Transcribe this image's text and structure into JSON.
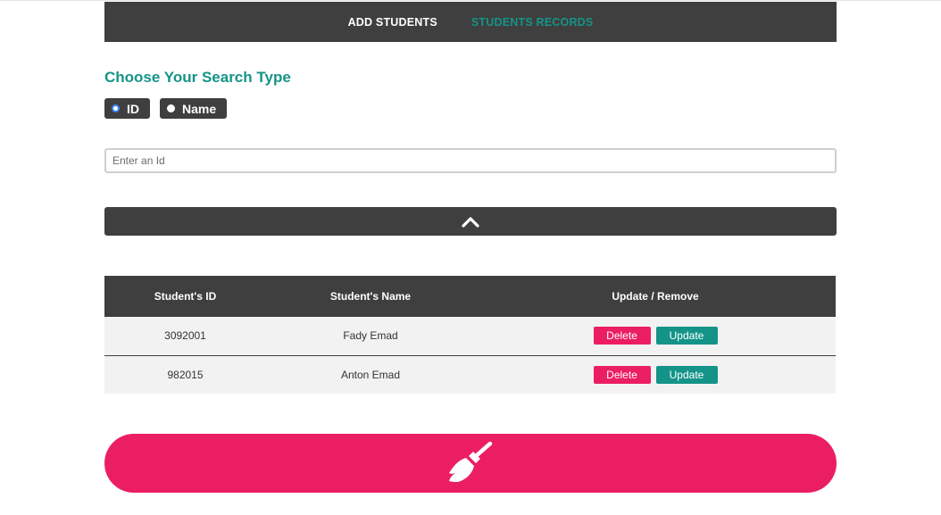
{
  "nav": {
    "add_students": "ADD STUDENTS",
    "students_records": "STUDENTS RECORDS"
  },
  "search": {
    "title": "Choose Your Search Type",
    "options": [
      {
        "label": "ID",
        "checked": true
      },
      {
        "label": "Name",
        "checked": false
      }
    ],
    "input_placeholder": "Enter an Id",
    "input_value": ""
  },
  "collapse": {
    "icon": "chevron-up-icon"
  },
  "table": {
    "headers": [
      "Student's ID",
      "Student's Name",
      "Update / Remove"
    ],
    "rows": [
      {
        "id": "3092001",
        "name": "Fady Emad",
        "delete_label": "Delete",
        "update_label": "Update"
      },
      {
        "id": "982015",
        "name": "Anton Emad",
        "delete_label": "Delete",
        "update_label": "Update"
      }
    ]
  },
  "clear": {
    "icon": "broom-icon"
  },
  "colors": {
    "dark": "#3f3f3f",
    "teal": "#149488",
    "pink": "#eb1e63",
    "row_bg": "#f2f2f2"
  }
}
